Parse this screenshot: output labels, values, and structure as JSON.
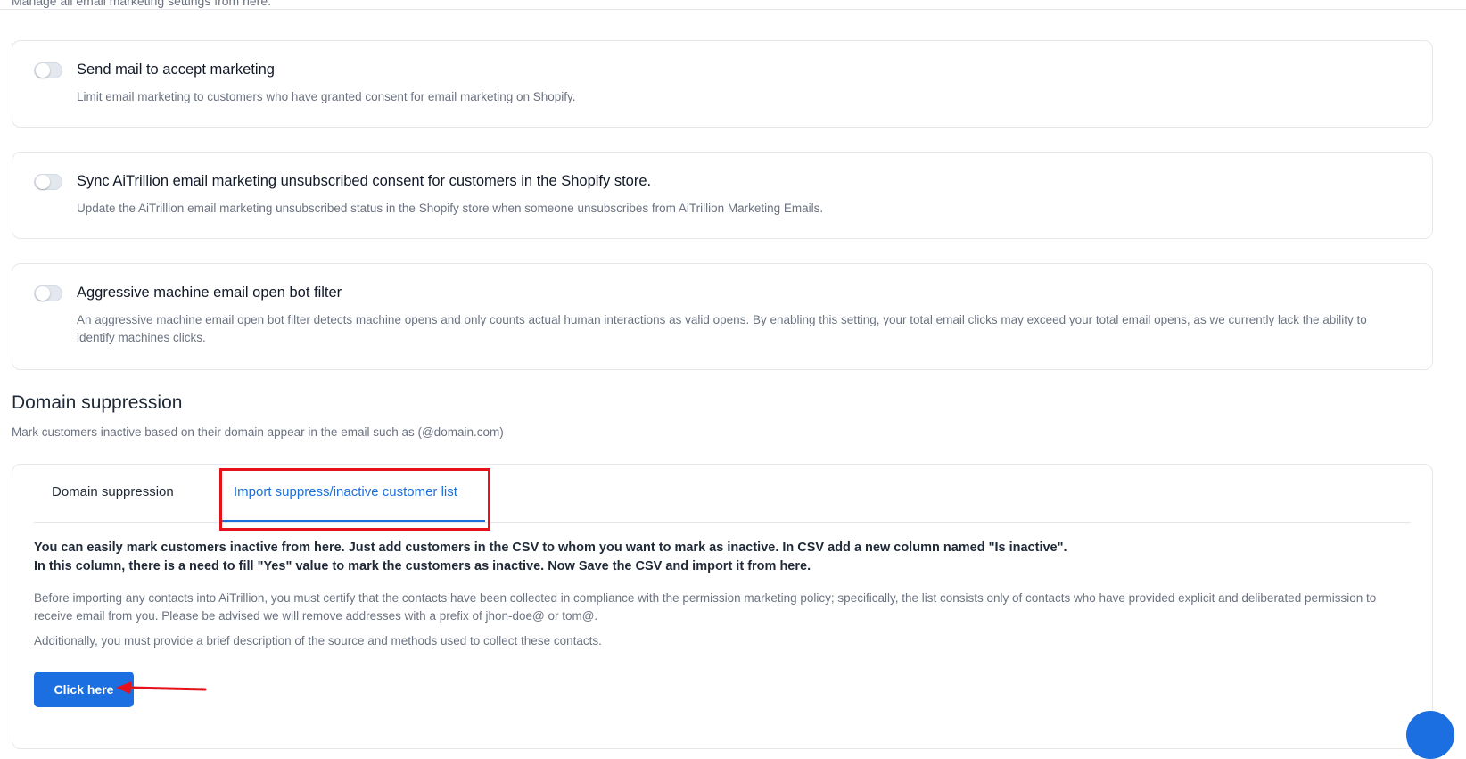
{
  "page": {
    "subtitle": "Manage all email marketing settings from here."
  },
  "settings": [
    {
      "title": "Send mail to accept marketing",
      "description": "Limit email marketing to customers who have granted consent for email marketing on Shopify.",
      "enabled": false
    },
    {
      "title": "Sync AiTrillion email marketing unsubscribed consent for customers in the Shopify store.",
      "description": "Update the AiTrillion email marketing unsubscribed status in the Shopify store when someone unsubscribes from AiTrillion Marketing Emails.",
      "enabled": false
    },
    {
      "title": "Aggressive machine email open bot filter",
      "description": "An aggressive machine email open bot filter detects machine opens and only counts actual human interactions as valid opens. By enabling this setting, your total email clicks may exceed your total email opens, as we currently lack the ability to identify machines clicks.",
      "enabled": false
    }
  ],
  "domain_suppression": {
    "title": "Domain suppression",
    "subtitle": "Mark customers inactive based on their domain appear in the email such as (@domain.com)",
    "tabs": [
      {
        "label": "Domain suppression",
        "active": false
      },
      {
        "label": "Import suppress/inactive customer list",
        "active": true
      }
    ],
    "instructions_line1": "You can easily mark customers inactive from here. Just add customers in the CSV to whom you want to mark as inactive. In CSV add a new column named \"Is inactive\".",
    "instructions_line2": "In this column, there is a need to fill \"Yes\" value to mark the customers as inactive. Now Save the CSV and import it from here.",
    "policy_text": "Before importing any contacts into AiTrillion, you must certify that the contacts have been collected in compliance with the permission marketing policy; specifically, the list consists only of contacts who have provided explicit and deliberated permission to receive email from you. Please be advised we will remove addresses with a prefix of jhon-doe@ or tom@.",
    "additional_text": "Additionally, you must provide a brief description of the source and methods used to collect these contacts.",
    "button_label": "Click here"
  },
  "colors": {
    "accent": "#1c6fe0",
    "annotation": "#e5121c",
    "border": "#e5e7eb",
    "muted_text": "#6b7280"
  }
}
